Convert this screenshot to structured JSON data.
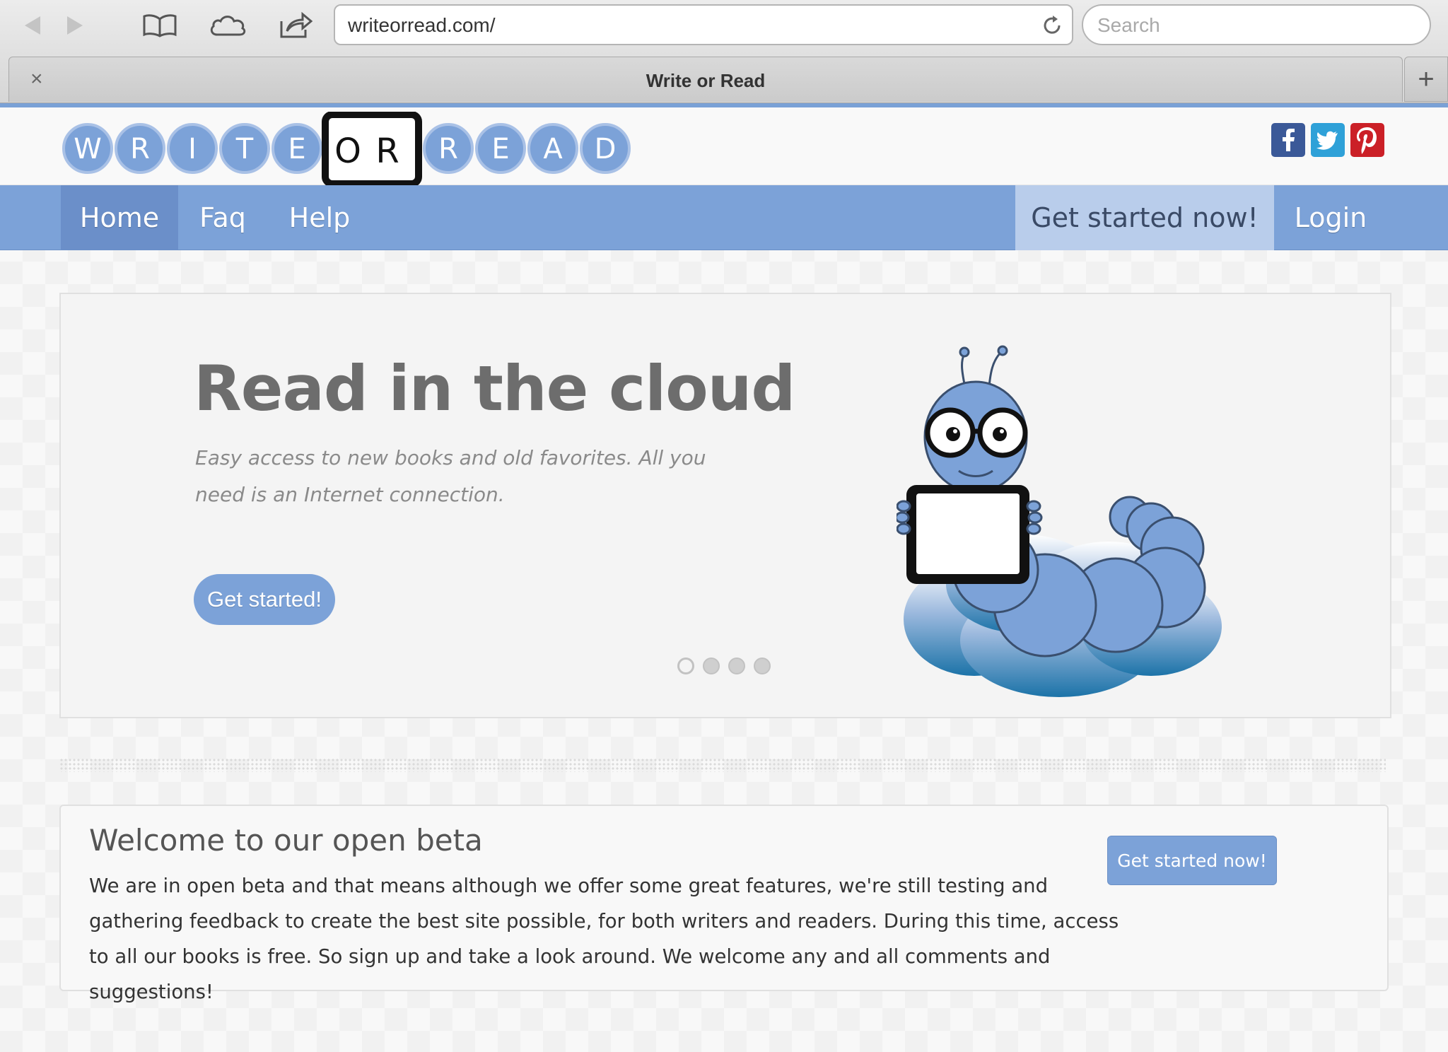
{
  "browser": {
    "url": "writeorread.com/",
    "search_placeholder": "Search",
    "tab_title": "Write or Read",
    "tab_close": "×",
    "new_tab": "+"
  },
  "header": {
    "logo_letters_left": [
      "W",
      "R",
      "I",
      "T",
      "E"
    ],
    "logo_letters_mid": [
      "O",
      "R"
    ],
    "logo_letters_right": [
      "R",
      "E",
      "A",
      "D"
    ],
    "social": [
      {
        "name": "facebook",
        "glyph": "f",
        "color": "#3b5998"
      },
      {
        "name": "twitter",
        "glyph": "t",
        "color": "#2fa1d8"
      },
      {
        "name": "pinterest",
        "glyph": "p",
        "color": "#cb2027"
      }
    ]
  },
  "nav": {
    "home": "Home",
    "faq": "Faq",
    "help": "Help",
    "get_started": "Get started now!",
    "login": "Login"
  },
  "hero": {
    "title": "Read in the cloud",
    "subtitle": "Easy access to new books and old favorites. All you need is an Internet connection.",
    "button": "Get started!",
    "slides": 4,
    "active_slide": 1
  },
  "welcome": {
    "title": "Welcome to our open beta",
    "body": "We are in open beta and that means although we offer some great features, we're still testing and gathering feedback to create the best site possible, for both writers and readers. During this time, access to all our books is free. So sign up and take a look around. We welcome any and all comments and suggestions!",
    "button": "Get started now!"
  },
  "colors": {
    "accent": "#7ca2d8",
    "nav_active": "#6b8fc9",
    "nav_cta": "#b9cdeb",
    "hero_title": "#6d6d6d"
  }
}
